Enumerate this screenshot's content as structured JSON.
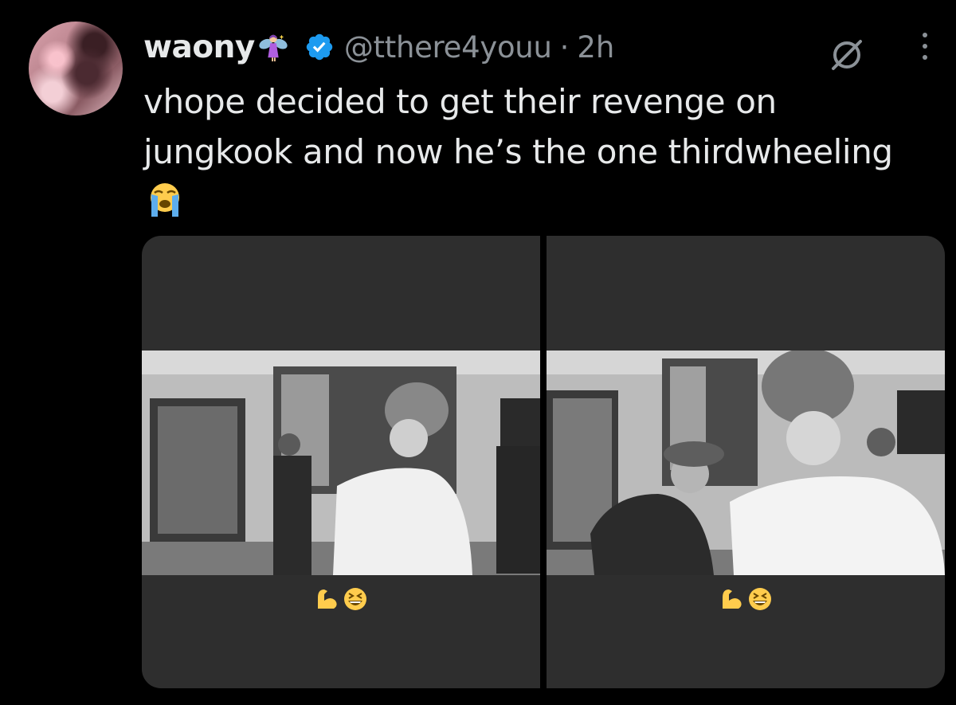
{
  "tweet": {
    "author_name": "waony",
    "author_handle": "@tthere4youu",
    "separator": "·",
    "timestamp": "2h",
    "text": "vhope decided to get their revenge on jungkook and now he’s the one thirdwheeling",
    "icons": {
      "name_emoji": "fairy-icon",
      "verified": "verified-badge-icon",
      "grok": "grok-icon",
      "more": "more-icon",
      "text_emoji": "loudly-crying-face-icon"
    }
  },
  "media": {
    "images": [
      {
        "caption_emojis": [
          "flexed-biceps-icon",
          "grinning-squinting-face-icon"
        ]
      },
      {
        "caption_emojis": [
          "flexed-biceps-icon",
          "grinning-squinting-face-icon"
        ]
      }
    ]
  },
  "colors": {
    "background": "#000000",
    "primary_text": "#e7e9ea",
    "secondary_text": "#8b9197",
    "verified_blue": "#1d9bf0",
    "media_bg": "#2e2e2e"
  }
}
